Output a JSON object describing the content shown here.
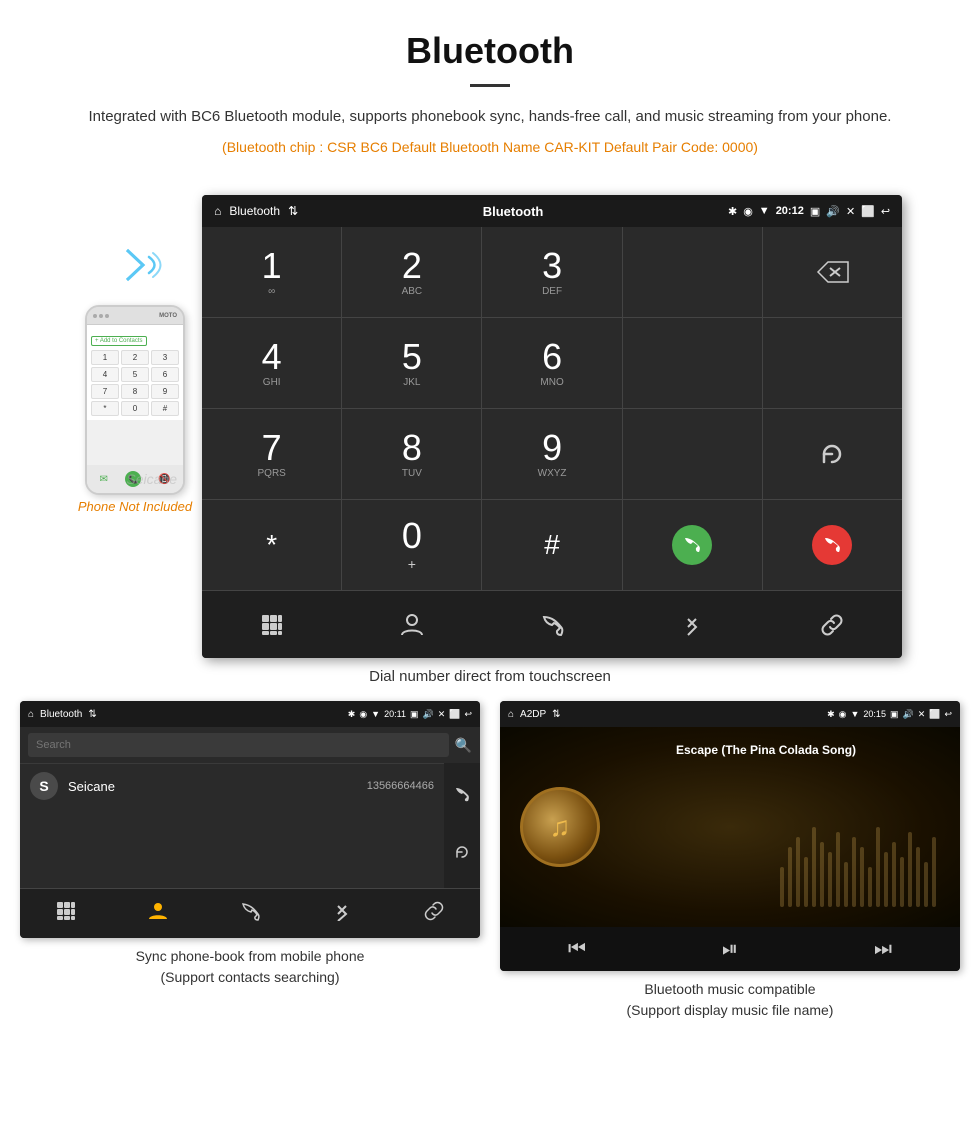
{
  "page": {
    "title": "Bluetooth",
    "divider": true,
    "description": "Integrated with BC6 Bluetooth module, supports phonebook sync, hands-free call, and music streaming from your phone.",
    "specs": "(Bluetooth chip : CSR BC6    Default Bluetooth Name CAR-KIT    Default Pair Code: 0000)"
  },
  "dial_screen": {
    "status_bar": {
      "left": [
        "🏠",
        "Bluetooth",
        "↕"
      ],
      "time": "20:12",
      "right_icons": [
        "📷",
        "🔊",
        "✕",
        "⬜",
        "↩"
      ]
    },
    "keys": [
      {
        "main": "1",
        "sub": "∞"
      },
      {
        "main": "2",
        "sub": "ABC"
      },
      {
        "main": "3",
        "sub": "DEF"
      },
      {
        "main": "",
        "sub": ""
      },
      {
        "main": "⌫",
        "sub": ""
      },
      {
        "main": "4",
        "sub": "GHI"
      },
      {
        "main": "5",
        "sub": "JKL"
      },
      {
        "main": "6",
        "sub": "MNO"
      },
      {
        "main": "",
        "sub": ""
      },
      {
        "main": "",
        "sub": ""
      },
      {
        "main": "7",
        "sub": "PQRS"
      },
      {
        "main": "8",
        "sub": "TUV"
      },
      {
        "main": "9",
        "sub": "WXYZ"
      },
      {
        "main": "",
        "sub": ""
      },
      {
        "main": "↺",
        "sub": ""
      },
      {
        "main": "*",
        "sub": ""
      },
      {
        "main": "0",
        "sub": "+"
      },
      {
        "main": "#",
        "sub": ""
      },
      {
        "main": "call",
        "sub": ""
      },
      {
        "main": "end",
        "sub": ""
      }
    ],
    "bottom_nav": [
      "⠿",
      "👤",
      "📞",
      "✱",
      "🔗"
    ]
  },
  "caption_dial": "Dial number direct from touchscreen",
  "phonebook_screen": {
    "status_bar": {
      "left": [
        "🏠",
        "Bluetooth",
        "↕"
      ],
      "time": "20:11",
      "right_icons": [
        "📷",
        "🔊",
        "✕",
        "⬜",
        "↩"
      ]
    },
    "search_placeholder": "Search",
    "contacts": [
      {
        "letter": "S",
        "name": "Seicane",
        "number": "13566664466"
      }
    ],
    "right_icons": [
      "📞",
      "↺"
    ],
    "bottom_nav_icons": [
      "⠿",
      "👤",
      "📞",
      "✱",
      "🔗"
    ],
    "active_nav": 1
  },
  "caption_phonebook": "Sync phone-book from mobile phone\n(Support contacts searching)",
  "music_screen": {
    "status_bar": {
      "left": [
        "🏠",
        "A2DP",
        "↕"
      ],
      "time": "20:15",
      "right_icons": [
        "📷",
        "🔊",
        "✕",
        "⬜",
        "↩"
      ]
    },
    "song_title": "Escape (The Pina Colada Song)",
    "controls": [
      "⏮",
      "⏯",
      "⏭"
    ]
  },
  "caption_music": "Bluetooth music compatible\n(Support display music file name)",
  "phone_not_included": "Phone Not Included",
  "seicane_watermark": "Seicane"
}
